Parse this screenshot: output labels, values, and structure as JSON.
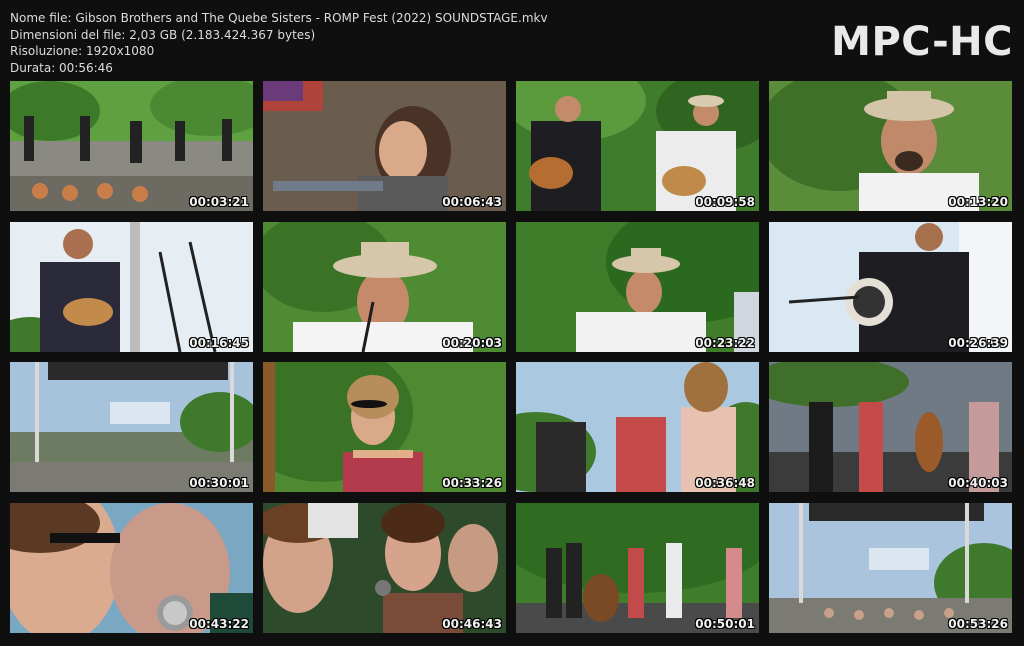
{
  "info": {
    "file_name": "Nome file: Gibson Brothers and The Quebe Sisters - ROMP Fest (2022) SOUNDSTAGE.mkv",
    "file_size": "Dimensioni del file: 2,03 GB (2.183.424.367 bytes)",
    "resolution": "Risoluzione: 1920x1080",
    "duration": "Durata: 00:56:46"
  },
  "logo": "MPC-HC",
  "thumbnails": [
    {
      "time": "00:03:21",
      "scene": "wide-stage"
    },
    {
      "time": "00:06:43",
      "scene": "girl-crowd"
    },
    {
      "time": "00:09:58",
      "scene": "two-guitarists"
    },
    {
      "time": "00:13:20",
      "scene": "cowboy-closeup"
    },
    {
      "time": "00:16:45",
      "scene": "mandolin-sky"
    },
    {
      "time": "00:20:03",
      "scene": "cowboy-mic"
    },
    {
      "time": "00:23:22",
      "scene": "cowboy-wide"
    },
    {
      "time": "00:26:39",
      "scene": "banjo-sky"
    },
    {
      "time": "00:30:01",
      "scene": "stage-rig"
    },
    {
      "time": "00:33:26",
      "scene": "fiddler-green"
    },
    {
      "time": "00:36:48",
      "scene": "three-fiddlers"
    },
    {
      "time": "00:40:03",
      "scene": "band-stage"
    },
    {
      "time": "00:43:22",
      "scene": "singer-profile"
    },
    {
      "time": "00:46:43",
      "scene": "singers-close"
    },
    {
      "time": "00:50:01",
      "scene": "band-green"
    },
    {
      "time": "00:53:26",
      "scene": "stage-rig-wide"
    }
  ]
}
